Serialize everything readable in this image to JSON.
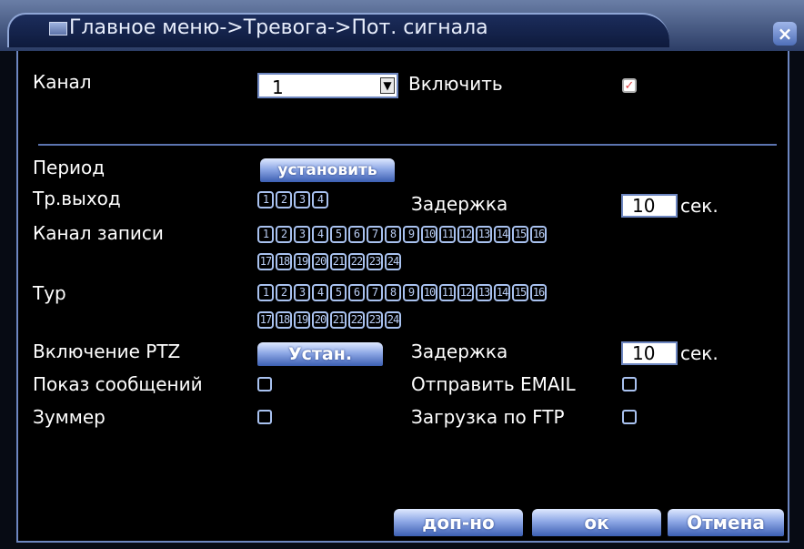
{
  "title": "Главное меню->Тревога->Пот. сигнала",
  "colors": {
    "accent": "#6d86c0",
    "background": "#000000",
    "button": "#3c5fb2"
  },
  "icons": {
    "title": "menu-icon",
    "close": "close-icon"
  },
  "channel": {
    "label": "Канал",
    "value": "1"
  },
  "enable": {
    "label": "Включить",
    "checked": true
  },
  "period": {
    "label": "Период",
    "button": "установить"
  },
  "alarm_out": {
    "label": "Тр.выход",
    "chips": [
      "1",
      "2",
      "3",
      "4"
    ],
    "delay_label": "Задержка",
    "delay_value": "10",
    "unit": "сек."
  },
  "record_channel": {
    "label": "Канал записи",
    "row1": [
      "1",
      "2",
      "3",
      "4",
      "5",
      "6",
      "7",
      "8",
      "9",
      "10",
      "11",
      "12",
      "13",
      "14",
      "15",
      "16"
    ],
    "row2": [
      "17",
      "18",
      "19",
      "20",
      "21",
      "22",
      "23",
      "24"
    ]
  },
  "tour": {
    "label": "Тур",
    "row1": [
      "1",
      "2",
      "3",
      "4",
      "5",
      "6",
      "7",
      "8",
      "9",
      "10",
      "11",
      "12",
      "13",
      "14",
      "15",
      "16"
    ],
    "row2": [
      "17",
      "18",
      "19",
      "20",
      "21",
      "22",
      "23",
      "24"
    ]
  },
  "ptz": {
    "label": "Включение PTZ",
    "button": "Устан.",
    "delay_label": "Задержка",
    "delay_value": "10",
    "unit": "сек."
  },
  "show_message": {
    "label": "Показ сообщений",
    "checked": false
  },
  "send_email": {
    "label": "Отправить EMAIL",
    "checked": false
  },
  "buzzer": {
    "label": "Зуммер",
    "checked": false
  },
  "ftp_upload": {
    "label": "Загрузка по FTP",
    "checked": false
  },
  "footer": {
    "advanced": "доп-но",
    "ok": "ок",
    "cancel": "Отмена"
  }
}
